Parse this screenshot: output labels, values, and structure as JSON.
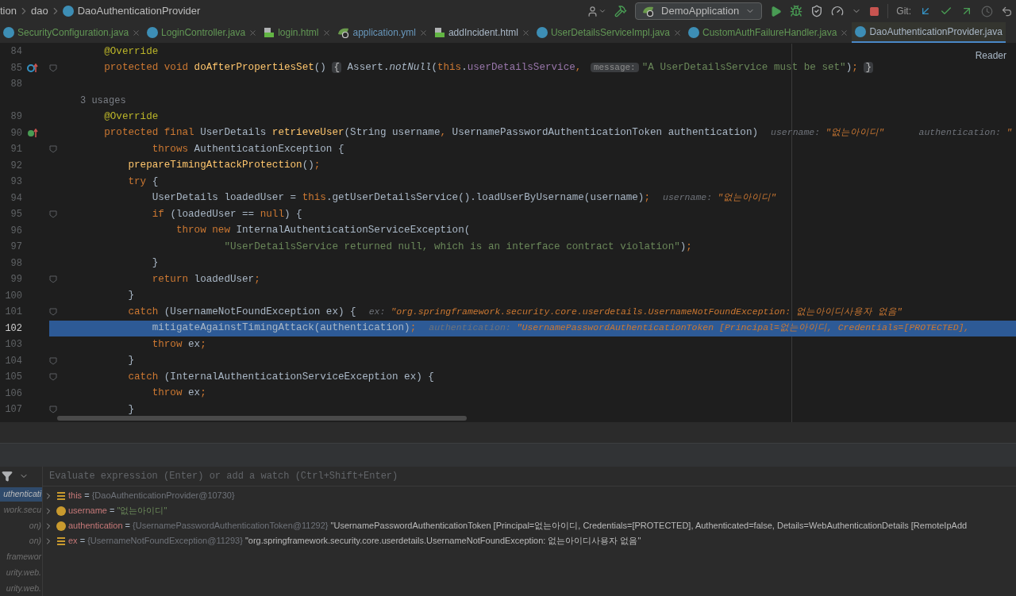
{
  "breadcrumbs": [
    {
      "label": "tion",
      "kind": "folder"
    },
    {
      "label": "dao",
      "kind": "folder"
    },
    {
      "label": "DaoAuthenticationProvider",
      "kind": "class"
    }
  ],
  "toolbar": {
    "run_config": "DemoApplication",
    "git_label": "Git:"
  },
  "tabs": [
    {
      "label": "SecurityConfiguration.java",
      "kind": "class",
      "color": "#629755",
      "selected": false
    },
    {
      "label": "LoginController.java",
      "kind": "class",
      "color": "#629755",
      "selected": false
    },
    {
      "label": "login.html",
      "kind": "html",
      "color": "#629755",
      "selected": false
    },
    {
      "label": "application.yml",
      "kind": "yml",
      "color": "#6897bb",
      "selected": false
    },
    {
      "label": "addIncident.html",
      "kind": "html",
      "color": "#a9b7c6",
      "selected": false
    },
    {
      "label": "UserDetailsServiceImpl.java",
      "kind": "class",
      "color": "#629755",
      "selected": false
    },
    {
      "label": "CustomAuthFailureHandler.java",
      "kind": "class",
      "color": "#629755",
      "selected": false
    },
    {
      "label": "DaoAuthenticationProvider.java",
      "kind": "class",
      "color": "#a9b7c6",
      "selected": true
    }
  ],
  "reader_mode": "Reader",
  "editor_lines": [
    {
      "kind": "code",
      "number": "84",
      "fold": false,
      "selected": false,
      "tokens": [
        {
          "kind": "ann",
          "text": "    @Override"
        }
      ]
    },
    {
      "kind": "code",
      "number": "85",
      "gutter": {
        "kind": "override"
      },
      "fold": true,
      "selected": false,
      "tokens": [
        {
          "kind": "kw",
          "text": "    protected void "
        },
        {
          "kind": "fn",
          "text": "doAfterPropertiesSet"
        },
        {
          "kind": "plain",
          "text": "() "
        },
        {
          "kind": "fold",
          "text": "{"
        },
        {
          "kind": "plain",
          "text": " Assert."
        },
        {
          "kind": "static",
          "text": "notNull"
        },
        {
          "kind": "plain",
          "text": "("
        },
        {
          "kind": "kw",
          "text": "this"
        },
        {
          "kind": "plain",
          "text": "."
        },
        {
          "kind": "field",
          "text": "userDetailsService"
        },
        {
          "kind": "kw",
          "text": ", "
        },
        {
          "kind": "param",
          "text": "message:"
        },
        {
          "kind": "str",
          "text": "\"A UserDetailsService must be set\""
        },
        {
          "kind": "plain",
          "text": ")"
        },
        {
          "kind": "kw",
          "text": "; "
        },
        {
          "kind": "fold",
          "text": "}"
        }
      ]
    },
    {
      "kind": "code",
      "number": "88",
      "fold": false,
      "selected": false
    },
    {
      "kind": "usages",
      "text": "3 usages"
    },
    {
      "kind": "code",
      "number": "89",
      "fold": false,
      "selected": false,
      "tokens": [
        {
          "kind": "ann",
          "text": "    @Override"
        }
      ]
    },
    {
      "kind": "code",
      "number": "90",
      "gutter": {
        "kind": "implements"
      },
      "fold": false,
      "selected": false,
      "tokens": [
        {
          "kind": "kw",
          "text": "    protected final "
        },
        {
          "kind": "plain",
          "text": "UserDetails "
        },
        {
          "kind": "fn",
          "text": "retrieveUser"
        },
        {
          "kind": "plain",
          "text": "(String username"
        },
        {
          "kind": "kw",
          "text": ", "
        },
        {
          "kind": "plain",
          "text": "UsernamePasswordAuthenticationToken authentication)"
        },
        {
          "kind": "hint_label",
          "text": "username: "
        },
        {
          "kind": "hint_val",
          "text": "\"없는아이디\""
        },
        {
          "kind": "hint_label",
          "text": "    authentication: "
        },
        {
          "kind": "hint_val",
          "text": "\""
        }
      ]
    },
    {
      "kind": "code",
      "number": "91",
      "fold": true,
      "selected": false,
      "tokens": [
        {
          "kind": "kw",
          "text": "            throws "
        },
        {
          "kind": "plain",
          "text": "AuthenticationException {"
        }
      ]
    },
    {
      "kind": "code",
      "number": "92",
      "fold": false,
      "selected": false,
      "tokens": [
        {
          "kind": "fn",
          "text": "        prepareTimingAttackProtection"
        },
        {
          "kind": "plain",
          "text": "()"
        },
        {
          "kind": "kw",
          "text": ";"
        }
      ]
    },
    {
      "kind": "code",
      "number": "93",
      "fold": false,
      "selected": false,
      "tokens": [
        {
          "kind": "kw",
          "text": "        try "
        },
        {
          "kind": "plain",
          "text": "{"
        }
      ]
    },
    {
      "kind": "code",
      "number": "94",
      "fold": false,
      "selected": false,
      "tokens": [
        {
          "kind": "plain",
          "text": "            UserDetails loadedUser = "
        },
        {
          "kind": "kw",
          "text": "this"
        },
        {
          "kind": "plain",
          "text": ".getUserDetailsService().loadUserByUsername(username)"
        },
        {
          "kind": "kw",
          "text": ";"
        },
        {
          "kind": "hint_label",
          "text": "username: "
        },
        {
          "kind": "hint_val",
          "text": "\"없는아이디\""
        }
      ]
    },
    {
      "kind": "code",
      "number": "95",
      "fold": true,
      "selected": false,
      "tokens": [
        {
          "kind": "kw",
          "text": "            if "
        },
        {
          "kind": "plain",
          "text": "(loadedUser == "
        },
        {
          "kind": "kw",
          "text": "null"
        },
        {
          "kind": "plain",
          "text": ") {"
        }
      ]
    },
    {
      "kind": "code",
      "number": "96",
      "fold": false,
      "selected": false,
      "tokens": [
        {
          "kind": "kw",
          "text": "                throw new "
        },
        {
          "kind": "plain",
          "text": "InternalAuthenticationServiceException("
        }
      ]
    },
    {
      "kind": "code",
      "number": "97",
      "fold": false,
      "selected": false,
      "tokens": [
        {
          "kind": "str",
          "text": "                        \"UserDetailsService returned null, which is an interface contract violation\""
        },
        {
          "kind": "plain",
          "text": ")"
        },
        {
          "kind": "kw",
          "text": ";"
        }
      ]
    },
    {
      "kind": "code",
      "number": "98",
      "fold": false,
      "selected": false,
      "tokens": [
        {
          "kind": "plain",
          "text": "            }"
        }
      ]
    },
    {
      "kind": "code",
      "number": "99",
      "fold": true,
      "selected": false,
      "tokens": [
        {
          "kind": "kw",
          "text": "            return "
        },
        {
          "kind": "plain",
          "text": "loadedUser"
        },
        {
          "kind": "kw",
          "text": ";"
        }
      ]
    },
    {
      "kind": "code",
      "number": "100",
      "fold": false,
      "selected": false,
      "tokens": [
        {
          "kind": "plain",
          "text": "        }"
        }
      ]
    },
    {
      "kind": "code",
      "number": "101",
      "fold": true,
      "selected": false,
      "tokens": [
        {
          "kind": "kw",
          "text": "        catch "
        },
        {
          "kind": "plain",
          "text": "(UsernameNotFoundException ex) {"
        },
        {
          "kind": "hint_label",
          "text": "ex: "
        },
        {
          "kind": "hint_val",
          "text": "\"org.springframework.security.core.userdetails.UsernameNotFoundException: 없는아이디사용자 없음\""
        }
      ]
    },
    {
      "kind": "code",
      "number": "102",
      "fold": false,
      "selected": true,
      "tokens": [
        {
          "kind": "plain",
          "text": "            mitigateAgainstTimingAttack(authentication)"
        },
        {
          "kind": "kw",
          "text": ";"
        },
        {
          "kind": "hint_label",
          "text": "authentication: "
        },
        {
          "kind": "hint_val",
          "text": "\"UsernamePasswordAuthenticationToken [Principal=없는아이디, Credentials=[PROTECTED],"
        }
      ]
    },
    {
      "kind": "code",
      "number": "103",
      "fold": false,
      "selected": false,
      "tokens": [
        {
          "kind": "kw",
          "text": "            throw "
        },
        {
          "kind": "plain",
          "text": "ex"
        },
        {
          "kind": "kw",
          "text": ";"
        }
      ]
    },
    {
      "kind": "code",
      "number": "104",
      "fold": true,
      "selected": false,
      "tokens": [
        {
          "kind": "plain",
          "text": "        }"
        }
      ]
    },
    {
      "kind": "code",
      "number": "105",
      "fold": true,
      "selected": false,
      "tokens": [
        {
          "kind": "kw",
          "text": "        catch "
        },
        {
          "kind": "plain",
          "text": "(InternalAuthenticationServiceException ex) {"
        }
      ]
    },
    {
      "kind": "code",
      "number": "106",
      "fold": false,
      "selected": false,
      "tokens": [
        {
          "kind": "kw",
          "text": "            throw "
        },
        {
          "kind": "plain",
          "text": "ex"
        },
        {
          "kind": "kw",
          "text": ";"
        }
      ]
    },
    {
      "kind": "code",
      "number": "107",
      "fold": true,
      "selected": false,
      "tokens": [
        {
          "kind": "plain",
          "text": "        }"
        }
      ]
    }
  ],
  "debugger": {
    "evaluate": {
      "placeholder": "Evaluate expression (Enter) or add a watch (Ctrl+Shift+Enter)"
    },
    "frames": [
      {
        "label": "uthenticati",
        "selected": true
      },
      {
        "label": "work.secu",
        "selected": false
      },
      {
        "label": "on)",
        "selected": false
      },
      {
        "label": "on)",
        "selected": false
      },
      {
        "label": "framewor",
        "selected": false
      },
      {
        "label": "urity.web.",
        "selected": false
      },
      {
        "label": "urity.web.",
        "selected": false
      }
    ],
    "variables": [
      {
        "kind": "field",
        "name": "this",
        "operator": "=",
        "type": "{DaoAuthenticationProvider@10730}"
      },
      {
        "kind": "param",
        "name": "username",
        "operator": "=",
        "value": {
          "kind": "string",
          "text": "\"없는아이디\""
        }
      },
      {
        "kind": "param",
        "name": "authentication",
        "operator": "=",
        "type": "{UsernamePasswordAuthenticationToken@11292}",
        "value": {
          "kind": "plain",
          "text": "\"UsernamePasswordAuthenticationToken [Principal=없는아이디, Credentials=[PROTECTED], Authenticated=false, Details=WebAuthenticationDetails [RemoteIpAdd"
        }
      },
      {
        "kind": "field",
        "name": "ex",
        "operator": "=",
        "type": "{UsernameNotFoundException@11293}",
        "value": {
          "kind": "plain",
          "text": "\"org.springframework.security.core.userdetails.UsernameNotFoundException: 없는아이디사용자 없음\""
        }
      }
    ]
  }
}
